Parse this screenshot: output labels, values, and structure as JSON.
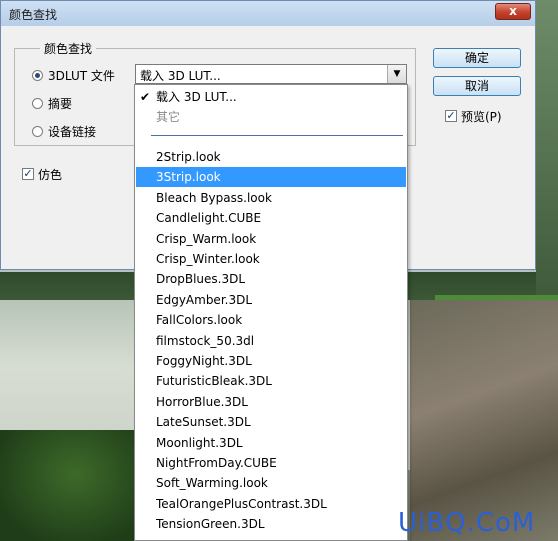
{
  "dialog": {
    "title": "颜色查找",
    "close_label": "x",
    "group_title": "颜色查找",
    "options": [
      {
        "label": "3DLUT 文件",
        "selected": true
      },
      {
        "label": "摘要",
        "selected": false
      },
      {
        "label": "设备链接",
        "selected": false
      }
    ],
    "dither_label": "仿色",
    "dither_checked": true,
    "select_value": "载入 3D LUT...",
    "ok_label": "确定",
    "cancel_label": "取消",
    "preview_label": "预览(P)",
    "preview_checked": true
  },
  "dropdown": {
    "header_items": [
      {
        "label": "载入 3D LUT...",
        "checked": true
      },
      {
        "label": "其它",
        "checked": false
      }
    ],
    "items": [
      "2Strip.look",
      "3Strip.look",
      "Bleach Bypass.look",
      "Candlelight.CUBE",
      "Crisp_Warm.look",
      "Crisp_Winter.look",
      "DropBlues.3DL",
      "EdgyAmber.3DL",
      "FallColors.look",
      "filmstock_50.3dl",
      "FoggyNight.3DL",
      "FuturisticBleak.3DL",
      "HorrorBlue.3DL",
      "LateSunset.3DL",
      "Moonlight.3DL",
      "NightFromDay.CUBE",
      "Soft_Warming.look",
      "TealOrangePlusContrast.3DL",
      "TensionGreen.3DL"
    ],
    "highlighted_index": 1
  },
  "watermark": "UiBQ.CoM",
  "colors": {
    "highlight": "#3399ff",
    "title_bar": "#cfe0f3",
    "close": "#c4412c"
  }
}
